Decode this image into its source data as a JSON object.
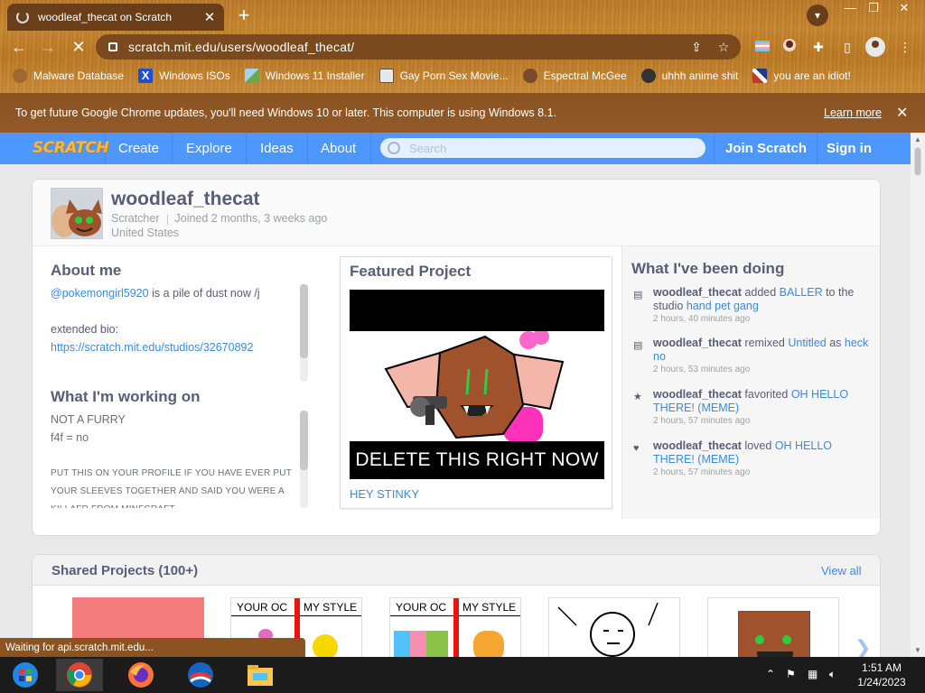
{
  "browser": {
    "tab_title": "woodleaf_thecat on Scratch",
    "url": "scratch.mit.edu/users/woodleaf_thecat/",
    "bookmarks": [
      {
        "label": "Malware Database",
        "icon": "globe-icon",
        "color": "#c4842f"
      },
      {
        "label": "Windows ISOs",
        "icon": "x-logo-icon",
        "color": "#1e4fd1"
      },
      {
        "label": "Windows 11 Installer",
        "icon": "image-icon",
        "color": "#6aa84f"
      },
      {
        "label": "Gay Porn Sex Movie...",
        "icon": "cube-icon",
        "color": "#555555"
      },
      {
        "label": "Espectral McGee",
        "icon": "avatar-icon",
        "color": "#7a4a2a"
      },
      {
        "label": "uhhh anime shit",
        "icon": "avatar-icon",
        "color": "#333333"
      },
      {
        "label": "you are an idiot!",
        "icon": "flag-icon",
        "color": "#c0392b"
      }
    ],
    "update_message": "To get future Google Chrome updates, you'll need Windows 10 or later. This computer is using Windows 8.1.",
    "learn_more": "Learn more",
    "status_text": "Waiting for api.scratch.mit.edu..."
  },
  "scratch_nav": {
    "logo": "SCRATCH",
    "links": [
      "Create",
      "Explore",
      "Ideas",
      "About"
    ],
    "search_placeholder": "Search",
    "join": "Join Scratch",
    "sign_in": "Sign in"
  },
  "profile": {
    "username": "woodleaf_thecat",
    "role": "Scratcher",
    "joined": "Joined 2 months, 3 weeks ago",
    "location": "United States"
  },
  "about": {
    "title": "About me",
    "mention": "@pokemongirl5920",
    "line1_rest": " is a pile of dust now /j",
    "extended": "extended bio:",
    "studio_link": "https://scratch.mit.edu/studios/32670892"
  },
  "working_on": {
    "title": "What I'm working on",
    "line1": "NOT A FURRY",
    "line2": "f4f = no",
    "upper1": "PUT THIS ON YOUR PROFILE IF YOU HAVE EVER PUT",
    "upper2": "YOUR SLEEVES TOGETHER AND SAID YOU WERE A",
    "upper3": "KILLAFR FROM MINFCRAFT"
  },
  "featured": {
    "title": "Featured Project",
    "caption": "DELETE THIS RIGHT NOW",
    "project_name": "HEY STINKY"
  },
  "activity": {
    "title": "What I've been doing",
    "items": [
      {
        "icon": "studio-icon",
        "user": "woodleaf_thecat",
        "action": " added ",
        "target": "BALLER",
        "middle": " to the studio ",
        "target2": "hand pet gang",
        "time": "2 hours, 40 minutes ago"
      },
      {
        "icon": "remix-icon",
        "user": "woodleaf_thecat",
        "action": " remixed ",
        "target": "Untitled",
        "middle": " as ",
        "target2": "heck no",
        "time": "2 hours, 53 minutes ago"
      },
      {
        "icon": "star-icon",
        "user": "woodleaf_thecat",
        "action": " favorited ",
        "target": "OH HELLO THERE! (MEME)",
        "middle": "",
        "target2": "",
        "time": "2 hours, 57 minutes ago"
      },
      {
        "icon": "heart-icon",
        "user": "woodleaf_thecat",
        "action": " loved ",
        "target": "OH HELLO THERE! (MEME)",
        "middle": "",
        "target2": "",
        "time": "2 hours, 57 minutes ago"
      }
    ]
  },
  "shared": {
    "title": "Shared Projects (100+)",
    "view_all": "View all",
    "oc_left": "YOUR OC",
    "oc_right": "MY STYLE"
  },
  "taskbar": {
    "time": "1:51 AM",
    "date": "1/24/2023"
  },
  "colors": {
    "scratch_blue": "#4d97ff",
    "link_blue": "#3c8bd9",
    "text_gray": "#575e75",
    "chrome_brown": "#8a531f"
  }
}
